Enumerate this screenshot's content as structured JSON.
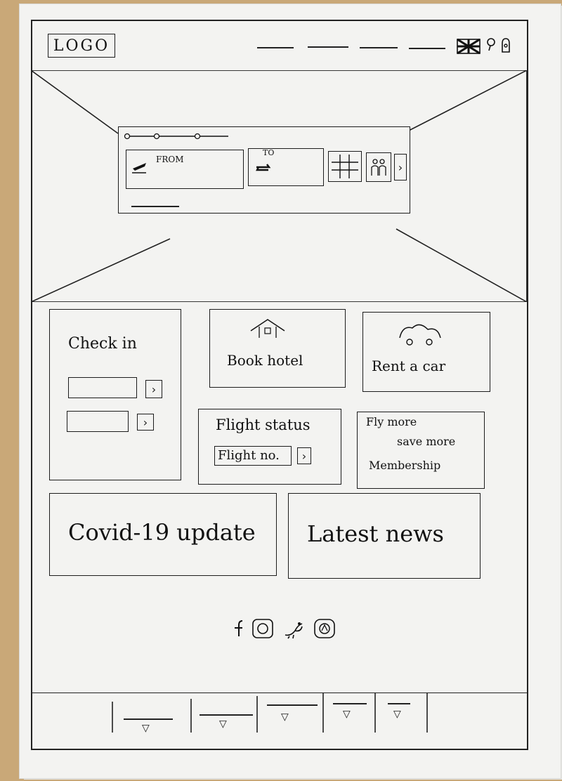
{
  "header": {
    "logo": "LOGO",
    "nav_item_count": 4,
    "icons": [
      "flag-icon",
      "search-icon",
      "lock-icon"
    ]
  },
  "booking": {
    "from_label": "FROM",
    "to_label": "TO"
  },
  "cards": {
    "checkin_title": "Check in",
    "hotel_title": "Book hotel",
    "car_title": "Rent a car",
    "flight_status_title": "Flight status",
    "flight_no_placeholder": "Flight no.",
    "membership_line1": "Fly more",
    "membership_line2": "save more",
    "membership_line3": "Membership",
    "covid_title": "Covid-19 update",
    "news_title": "Latest news"
  },
  "social": [
    "facebook-icon",
    "instagram-icon",
    "twitter-icon",
    "other-social-icon"
  ],
  "footer": {
    "dropdown_count": 5,
    "arrow_glyph": "▽"
  }
}
